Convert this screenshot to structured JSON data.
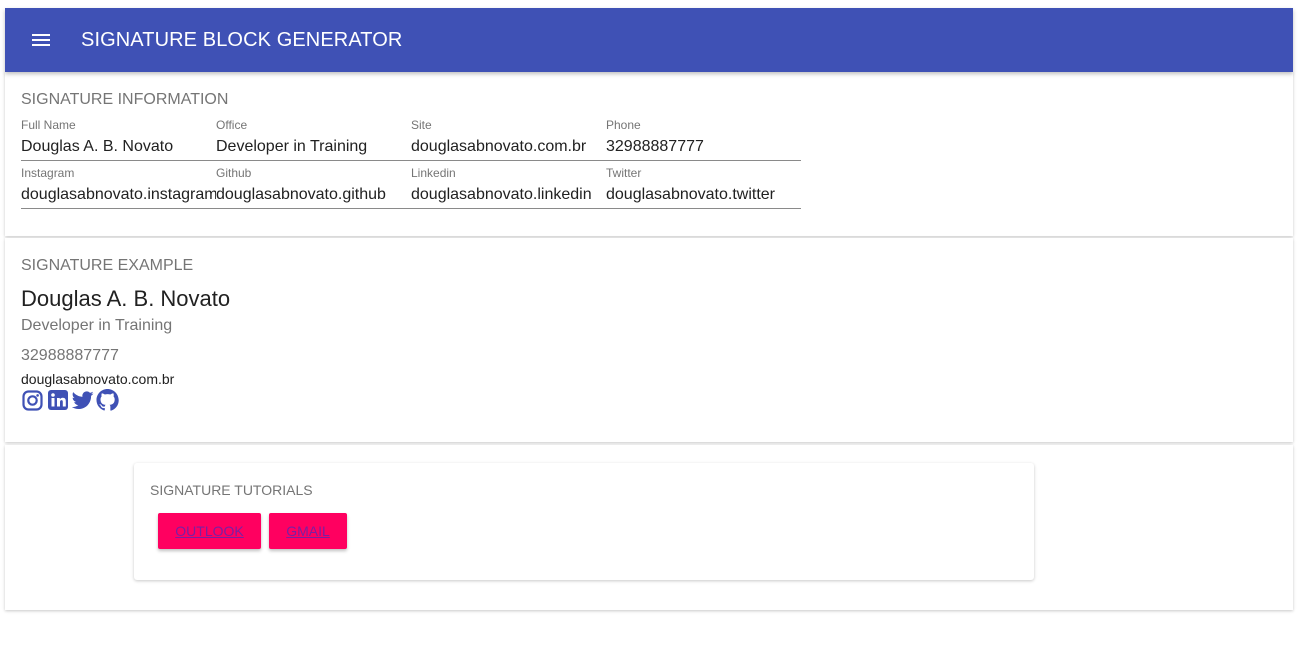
{
  "app": {
    "title": "SIGNATURE BLOCK GENERATOR",
    "primary_color": "#3f51b5",
    "accent_color": "#ff0060"
  },
  "info": {
    "title": "SIGNATURE INFORMATION",
    "fields": [
      {
        "label": "Full Name",
        "value": "Douglas A. B. Novato"
      },
      {
        "label": "Office",
        "value": "Developer in Training"
      },
      {
        "label": "Site",
        "value": "douglasabnovato.com.br"
      },
      {
        "label": "Phone",
        "value": "32988887777"
      },
      {
        "label": "Instagram",
        "value": "douglasabnovato.instagram"
      },
      {
        "label": "Github",
        "value": "douglasabnovato.github"
      },
      {
        "label": "Linkedin",
        "value": "douglasabnovato.linkedin"
      },
      {
        "label": "Twitter",
        "value": "douglasabnovato.twitter"
      }
    ]
  },
  "example": {
    "title": "SIGNATURE EXAMPLE",
    "name": "Douglas A. B. Novato",
    "office": "Developer in Training",
    "phone": "32988887777",
    "site": "douglasabnovato.com.br",
    "icons": [
      "instagram-icon",
      "linkedin-icon",
      "twitter-icon",
      "github-icon"
    ]
  },
  "tutorials": {
    "title": "SIGNATURE TUTORIALS",
    "buttons": [
      "OUTLOOK",
      "GMAIL"
    ]
  }
}
